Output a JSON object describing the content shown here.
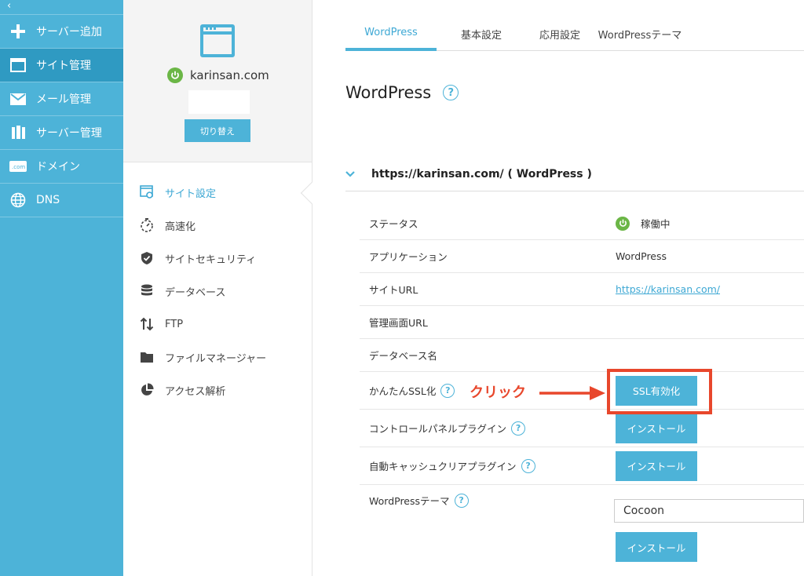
{
  "nav": {
    "back": "‹",
    "items": [
      {
        "label": "サーバー追加",
        "icon": "plus-icon"
      },
      {
        "label": "サイト管理",
        "icon": "browser-icon"
      },
      {
        "label": "メール管理",
        "icon": "mail-icon"
      },
      {
        "label": "サーバー管理",
        "icon": "server-icon"
      },
      {
        "label": "ドメイン",
        "icon": "domain-icon"
      },
      {
        "label": "DNS",
        "icon": "globe-icon"
      }
    ]
  },
  "site": {
    "domain": "karinsan.com",
    "switch_label": "切り替え"
  },
  "menu": [
    {
      "label": "サイト設定",
      "icon": "settings-page-icon"
    },
    {
      "label": "高速化",
      "icon": "stopwatch-icon"
    },
    {
      "label": "サイトセキュリティ",
      "icon": "shield-icon"
    },
    {
      "label": "データベース",
      "icon": "database-icon"
    },
    {
      "label": "FTP",
      "icon": "updown-arrows-icon"
    },
    {
      "label": "ファイルマネージャー",
      "icon": "folder-icon"
    },
    {
      "label": "アクセス解析",
      "icon": "pie-chart-icon"
    }
  ],
  "tabs": [
    "WordPress",
    "基本設定",
    "応用設定",
    "WordPressテーマ"
  ],
  "page": {
    "title": "WordPress",
    "help": "?",
    "section_title": "https://karinsan.com/ ( WordPress )"
  },
  "rows": {
    "status": {
      "label": "ステータス",
      "value": "稼働中"
    },
    "app": {
      "label": "アプリケーション",
      "value": "WordPress"
    },
    "site_url": {
      "label": "サイトURL",
      "value": "https://karinsan.com/"
    },
    "admin_url": {
      "label": "管理画面URL"
    },
    "db_name": {
      "label": "データベース名"
    },
    "ssl": {
      "label": "かんたんSSL化",
      "button": "SSL有効化"
    },
    "control_plugin": {
      "label": "コントロールパネルプラグイン",
      "button": "インストール"
    },
    "cache_plugin": {
      "label": "自動キャッシュクリアプラグイン",
      "button": "インストール"
    },
    "theme": {
      "label": "WordPressテーマ",
      "value": "Cocoon",
      "button": "インストール"
    }
  },
  "annotation": {
    "text": "クリック",
    "color": "#e8472c"
  },
  "colors": {
    "accent": "#4db3d8",
    "nav_active": "#2f9ac2",
    "status_green": "#6bb646"
  }
}
